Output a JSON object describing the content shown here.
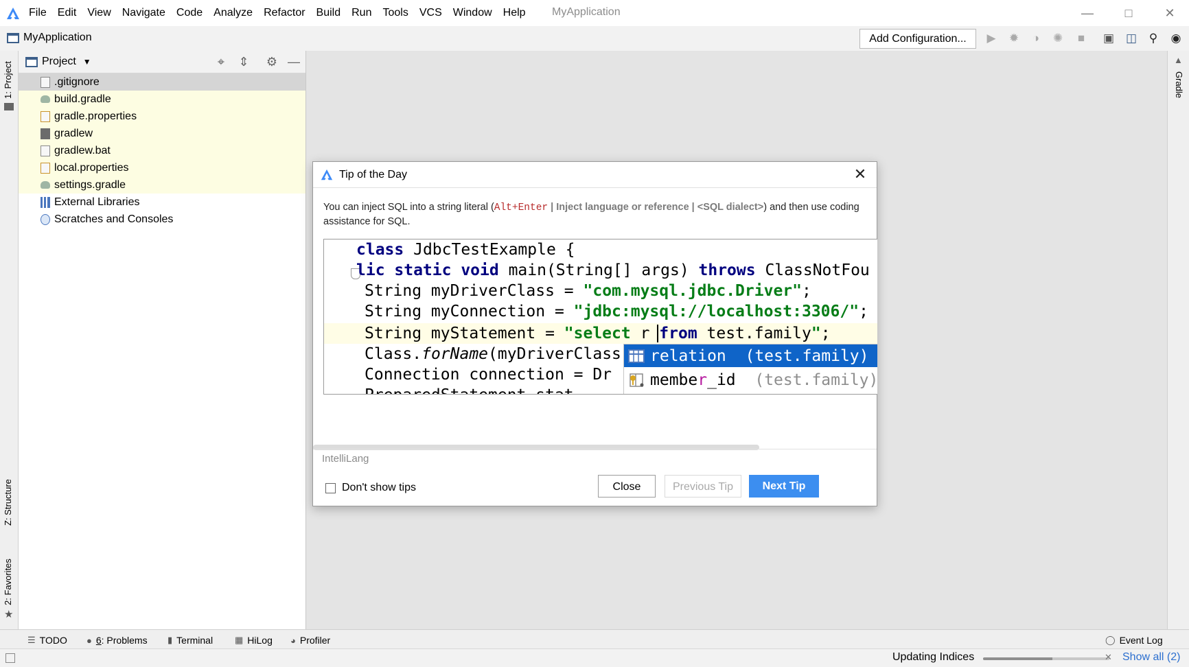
{
  "menubar": {
    "items": [
      "File",
      "Edit",
      "View",
      "Navigate",
      "Code",
      "Analyze",
      "Refactor",
      "Build",
      "Run",
      "Tools",
      "VCS",
      "Window",
      "Help"
    ],
    "window_title": "MyApplication"
  },
  "navbar": {
    "project_name": "MyApplication",
    "add_configuration": "Add Configuration..."
  },
  "left_stripe": {
    "project_tab": "1: Project",
    "structure_tab": "Z: Structure",
    "favorites_tab": "2: Favorites"
  },
  "right_stripe": {
    "gradle_tab": "Gradle"
  },
  "project_panel": {
    "title": "Project",
    "items": [
      {
        "label": ".gitignore",
        "icon": "file-icon",
        "state": "selected"
      },
      {
        "label": "build.gradle",
        "icon": "gradle-elephant-icon",
        "state": "highlighted"
      },
      {
        "label": "gradle.properties",
        "icon": "properties-file-icon",
        "state": "highlighted"
      },
      {
        "label": "gradlew",
        "icon": "shell-script-icon",
        "state": "highlighted"
      },
      {
        "label": "gradlew.bat",
        "icon": "batch-file-icon",
        "state": "highlighted"
      },
      {
        "label": "local.properties",
        "icon": "properties-file-icon",
        "state": "highlighted"
      },
      {
        "label": "settings.gradle",
        "icon": "gradle-elephant-icon",
        "state": "highlighted"
      },
      {
        "label": "External Libraries",
        "icon": "libraries-icon",
        "state": "normal"
      },
      {
        "label": "Scratches and Consoles",
        "icon": "scratches-icon",
        "state": "normal"
      }
    ]
  },
  "dialog": {
    "title": "Tip of the Day",
    "tip": {
      "before": "You can inject SQL into a string literal (",
      "shortcut": "Alt+Enter",
      "sep1": " | ",
      "action": "Inject language or reference",
      "sep2": " | ",
      "dialect": "<SQL dialect>",
      "after": ") and then use coding assistance for SQL."
    },
    "code": {
      "line1": {
        "kw": "class",
        "rest": " JdbcTestExample {"
      },
      "line2": {
        "kw1": "lic static void",
        "mid": " main(String[] args) ",
        "kw2": "throws",
        "rest": " ClassNotFou"
      },
      "line3": {
        "pre": "String myDriverClass = ",
        "str": "\"com.mysql.jdbc.Driver\"",
        "post": ";"
      },
      "line4": {
        "pre": "String myConnection = ",
        "str": "\"jdbc:mysql://localhost:3306/\"",
        "post": ";"
      },
      "line5": {
        "pre": "String myStatement = ",
        "str1": "\"select",
        "mid": " r ",
        "kw": "from",
        "rest": " test.family",
        "str2": "\"",
        "post": ";"
      },
      "line6": {
        "pre": "Class.",
        "it": "forName",
        "post": "(myDriverClass"
      },
      "line7": {
        "pre": "Connection connection = Dr"
      },
      "line8": {
        "pre": "PreparedStatement stat"
      }
    },
    "completion": [
      {
        "name": "relation",
        "type": "(test.family)",
        "icon": "table-icon",
        "selected": true
      },
      {
        "name_pre": "membe",
        "name_hl": "r",
        "name_post": "_id",
        "type": "(test.family)",
        "icon": "key-column-icon",
        "selected": false
      }
    ],
    "source": "IntelliLang",
    "dont_show": "Don't show tips",
    "buttons": {
      "close": "Close",
      "previous": "Previous Tip",
      "next": "Next Tip"
    },
    "accent_color": "#3c8ef0"
  },
  "bottom_bar": {
    "todo": "TODO",
    "problems_num": "6",
    "problems": ": Problems",
    "terminal": "Terminal",
    "hilog": "HiLog",
    "profiler": "Profiler",
    "event_log": "Event Log"
  },
  "status_bar": {
    "task": "Updating Indices",
    "progress": 0.55,
    "show_all": "Show all (2)"
  }
}
